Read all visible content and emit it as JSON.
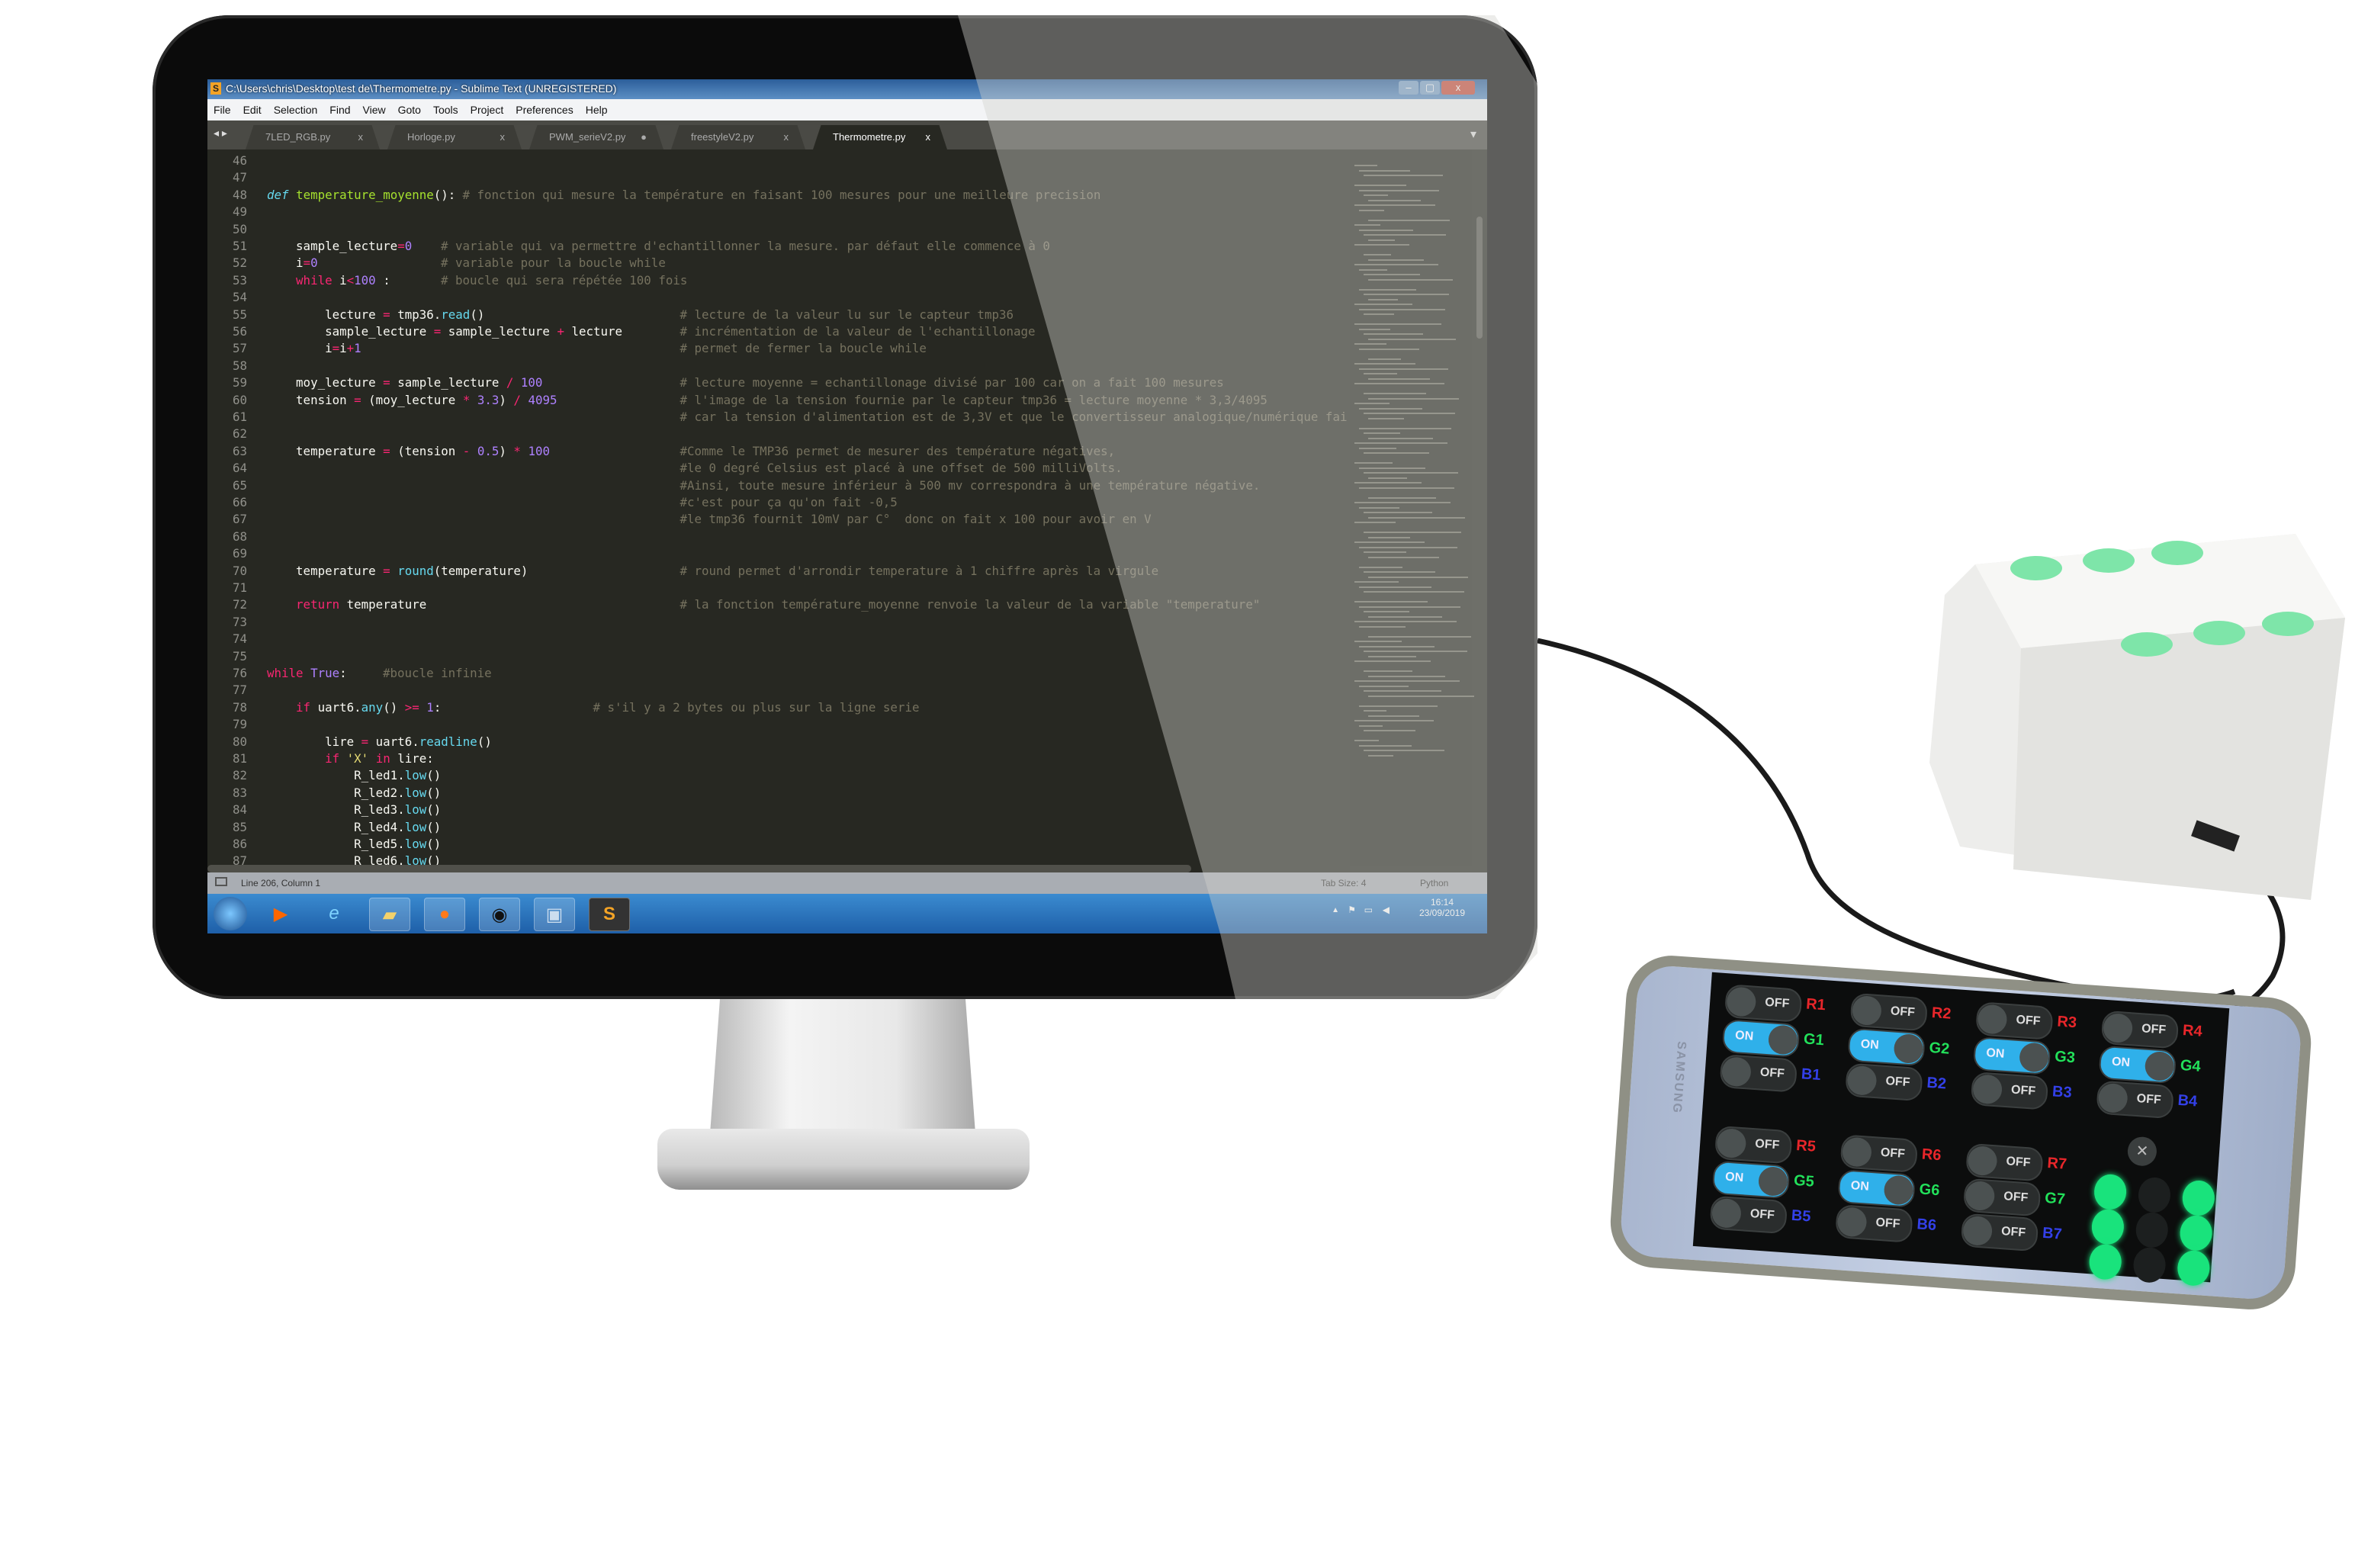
{
  "window": {
    "title": "C:\\Users\\chris\\Desktop\\test de\\Thermometre.py - Sublime Text (UNREGISTERED)",
    "controls": {
      "minimize": "–",
      "maximize": "▢",
      "close": "x"
    }
  },
  "menu": [
    "File",
    "Edit",
    "Selection",
    "Find",
    "View",
    "Goto",
    "Tools",
    "Project",
    "Preferences",
    "Help"
  ],
  "tabs": [
    {
      "label": "7LED_RGB.py",
      "close": "x"
    },
    {
      "label": "Horloge.py",
      "close": "x"
    },
    {
      "label": "PWM_serieV2.py",
      "close": "●"
    },
    {
      "label": "freestyleV2.py",
      "close": "x"
    },
    {
      "label": "Thermometre.py",
      "close": "x",
      "active": true
    }
  ],
  "tab_nav": "◂ ▸",
  "tab_dropdown": "▾",
  "code": [
    {
      "n": "46",
      "t": [],
      "c": ""
    },
    {
      "n": "47",
      "t": [],
      "c": ""
    },
    {
      "n": "48",
      "t": [
        [
          "def",
          "df"
        ],
        [
          " "
        ],
        [
          "temperature_moyenne",
          "fn"
        ],
        [
          "():"
        ]
      ],
      "c": "# fonction qui mesure la température en faisant 100 mesures pour une meilleure precision"
    },
    {
      "n": "49",
      "t": [],
      "c": ""
    },
    {
      "n": "50",
      "t": [],
      "c": ""
    },
    {
      "n": "51",
      "t": [
        [
          "    sample_lecture"
        ],
        [
          "=",
          "op"
        ],
        [
          "0",
          "nu"
        ]
      ],
      "c": "# variable qui va permettre d'echantillonner la mesure. par défaut elle commence à 0"
    },
    {
      "n": "52",
      "t": [
        [
          "    i"
        ],
        [
          "=",
          "op"
        ],
        [
          "0",
          "nu"
        ]
      ],
      "c": "# variable pour la boucle while"
    },
    {
      "n": "53",
      "t": [
        [
          "    "
        ],
        [
          "while",
          "kw"
        ],
        [
          " i"
        ],
        [
          "<",
          "op"
        ],
        [
          "100",
          "nu"
        ],
        [
          " :"
        ]
      ],
      "c": "# boucle qui sera répétée 100 fois"
    },
    {
      "n": "54",
      "t": [],
      "c": ""
    },
    {
      "n": "55",
      "t": [
        [
          "        lecture "
        ],
        [
          "=",
          "op"
        ],
        [
          " tmp36."
        ],
        [
          "read",
          "bi"
        ],
        [
          "()"
        ]
      ],
      "c": "# lecture de la valeur lu sur le capteur tmp36"
    },
    {
      "n": "56",
      "t": [
        [
          "        sample_lecture "
        ],
        [
          "=",
          "op"
        ],
        [
          " sample_lecture "
        ],
        [
          "+",
          "op"
        ],
        [
          " lecture"
        ]
      ],
      "c": "# incrémentation de la valeur de l'echantillonage"
    },
    {
      "n": "57",
      "t": [
        [
          "        i"
        ],
        [
          "=",
          "op"
        ],
        [
          "i"
        ],
        [
          "+",
          "op"
        ],
        [
          "1",
          "nu"
        ]
      ],
      "c": "# permet de fermer la boucle while"
    },
    {
      "n": "58",
      "t": [],
      "c": ""
    },
    {
      "n": "59",
      "t": [
        [
          "    moy_lecture "
        ],
        [
          "=",
          "op"
        ],
        [
          " sample_lecture "
        ],
        [
          "/",
          "op"
        ],
        [
          " "
        ],
        [
          "100",
          "nu"
        ]
      ],
      "c": "# lecture moyenne = echantillonage divisé par 100 car on a fait 100 mesures"
    },
    {
      "n": "60",
      "t": [
        [
          "    tension "
        ],
        [
          "=",
          "op"
        ],
        [
          " (moy_lecture "
        ],
        [
          "*",
          "op"
        ],
        [
          " "
        ],
        [
          "3.3",
          "nu"
        ],
        [
          ") "
        ],
        [
          "/",
          "op"
        ],
        [
          " "
        ],
        [
          "4095",
          "nu"
        ]
      ],
      "c": "# l'image de la tension fournie par le capteur tmp36 = lecture moyenne * 3,3/4095"
    },
    {
      "n": "61",
      "t": [],
      "c": "# car la tension d'alimentation est de 3,3V et que le convertisseur analogique/numérique fai"
    },
    {
      "n": "62",
      "t": [],
      "c": ""
    },
    {
      "n": "63",
      "t": [
        [
          "    temperature "
        ],
        [
          "=",
          "op"
        ],
        [
          " (tension "
        ],
        [
          "-",
          "op"
        ],
        [
          " "
        ],
        [
          "0.5",
          "nu"
        ],
        [
          ") "
        ],
        [
          "*",
          "op"
        ],
        [
          " "
        ],
        [
          "100",
          "nu"
        ]
      ],
      "c": "#Comme le TMP36 permet de mesurer des température négatives,"
    },
    {
      "n": "64",
      "t": [],
      "c": "#le 0 degré Celsius est placé à une offset de 500 milliVolts."
    },
    {
      "n": "65",
      "t": [],
      "c": "#Ainsi, toute mesure inférieur à 500 mv correspondra à une température négative."
    },
    {
      "n": "66",
      "t": [],
      "c": "#c'est pour ça qu'on fait -0,5"
    },
    {
      "n": "67",
      "t": [],
      "c": "#le tmp36 fournit 10mV par C°  donc on fait x 100 pour avoir en V"
    },
    {
      "n": "68",
      "t": [],
      "c": ""
    },
    {
      "n": "69",
      "t": [],
      "c": ""
    },
    {
      "n": "70",
      "t": [
        [
          "    temperature "
        ],
        [
          "=",
          "op"
        ],
        [
          " "
        ],
        [
          "round",
          "bi"
        ],
        [
          "(temperature)"
        ]
      ],
      "c": "# round permet d'arrondir temperature à 1 chiffre après la virgule"
    },
    {
      "n": "71",
      "t": [],
      "c": ""
    },
    {
      "n": "72",
      "t": [
        [
          "    "
        ],
        [
          "return",
          "kw"
        ],
        [
          " temperature"
        ]
      ],
      "c": "# la fonction température_moyenne renvoie la valeur de la variable \"temperature\""
    },
    {
      "n": "73",
      "t": [],
      "c": ""
    },
    {
      "n": "74",
      "t": [],
      "c": ""
    },
    {
      "n": "75",
      "t": [],
      "c": ""
    },
    {
      "n": "76",
      "t": [
        [
          "while",
          "kw"
        ],
        [
          " "
        ],
        [
          "True",
          "nu"
        ],
        [
          ":"
        ]
      ],
      "c": "#boucle infinie"
    },
    {
      "n": "77",
      "t": [],
      "c": ""
    },
    {
      "n": "78",
      "t": [
        [
          "    "
        ],
        [
          "if",
          "kw"
        ],
        [
          " uart6."
        ],
        [
          "any",
          "bi"
        ],
        [
          "() "
        ],
        [
          ">=",
          "op"
        ],
        [
          " "
        ],
        [
          "1",
          "nu"
        ],
        [
          ":"
        ]
      ],
      "c": "# s'il y a 2 bytes ou plus sur la ligne serie"
    },
    {
      "n": "79",
      "t": [],
      "c": ""
    },
    {
      "n": "80",
      "t": [
        [
          "        lire "
        ],
        [
          "=",
          "op"
        ],
        [
          " uart6."
        ],
        [
          "readline",
          "bi"
        ],
        [
          "()"
        ]
      ],
      "c": ""
    },
    {
      "n": "81",
      "t": [
        [
          "        "
        ],
        [
          "if",
          "kw"
        ],
        [
          " "
        ],
        [
          "'X'",
          "sr"
        ],
        [
          " "
        ],
        [
          "in",
          "kw"
        ],
        [
          " lire:"
        ]
      ],
      "c": ""
    },
    {
      "n": "82",
      "t": [
        [
          "            R_led1."
        ],
        [
          "low",
          "bi"
        ],
        [
          "()"
        ]
      ],
      "c": ""
    },
    {
      "n": "83",
      "t": [
        [
          "            R_led2."
        ],
        [
          "low",
          "bi"
        ],
        [
          "()"
        ]
      ],
      "c": ""
    },
    {
      "n": "84",
      "t": [
        [
          "            R_led3."
        ],
        [
          "low",
          "bi"
        ],
        [
          "()"
        ]
      ],
      "c": ""
    },
    {
      "n": "85",
      "t": [
        [
          "            R_led4."
        ],
        [
          "low",
          "bi"
        ],
        [
          "()"
        ]
      ],
      "c": ""
    },
    {
      "n": "86",
      "t": [
        [
          "            R_led5."
        ],
        [
          "low",
          "bi"
        ],
        [
          "()"
        ]
      ],
      "c": ""
    },
    {
      "n": "87",
      "t": [
        [
          "            R_led6."
        ],
        [
          "low",
          "bi"
        ],
        [
          "()"
        ]
      ],
      "c": ""
    }
  ],
  "status": {
    "position": "Line 206, Column 1",
    "tab_size": "Tab Size: 4",
    "syntax": "Python"
  },
  "taskbar": {
    "icons": [
      "start-orb",
      "media-player",
      "internet-explorer",
      "file-explorer",
      "firefox",
      "camera",
      "image-viewer",
      "sublime-text"
    ],
    "tray": {
      "arrow": "▲",
      "time": "16:14",
      "date": "23/09/2019"
    }
  },
  "phone": {
    "brand": "SAMSUNG",
    "switches_top": [
      [
        {
          "label": "R1",
          "state": "OFF"
        },
        {
          "label": "R2",
          "state": "OFF"
        },
        {
          "label": "R3",
          "state": "OFF"
        },
        {
          "label": "R4",
          "state": "OFF"
        }
      ],
      [
        {
          "label": "G1",
          "state": "ON"
        },
        {
          "label": "G2",
          "state": "ON"
        },
        {
          "label": "G3",
          "state": "ON"
        },
        {
          "label": "G4",
          "state": "ON"
        }
      ],
      [
        {
          "label": "B1",
          "state": "OFF"
        },
        {
          "label": "B2",
          "state": "OFF"
        },
        {
          "label": "B3",
          "state": "OFF"
        },
        {
          "label": "B4",
          "state": "OFF"
        }
      ]
    ],
    "switches_bottom": [
      [
        {
          "label": "R5",
          "state": "OFF"
        },
        {
          "label": "R6",
          "state": "OFF"
        },
        {
          "label": "R7",
          "state": "OFF"
        }
      ],
      [
        {
          "label": "G5",
          "state": "ON"
        },
        {
          "label": "G6",
          "state": "ON"
        },
        {
          "label": "G7",
          "state": "OFF"
        }
      ],
      [
        {
          "label": "B5",
          "state": "OFF"
        },
        {
          "label": "B6",
          "state": "OFF"
        },
        {
          "label": "B7",
          "state": "OFF"
        }
      ]
    ],
    "close_button": "✕",
    "led_dots": [
      true,
      false,
      true,
      true,
      false,
      true,
      true,
      false,
      true
    ],
    "colors": {
      "red": "#e8262a",
      "green": "#22e05a",
      "blue": "#3340e8",
      "led": "#19e37c",
      "toggle_on": "#2fb0ea"
    }
  }
}
